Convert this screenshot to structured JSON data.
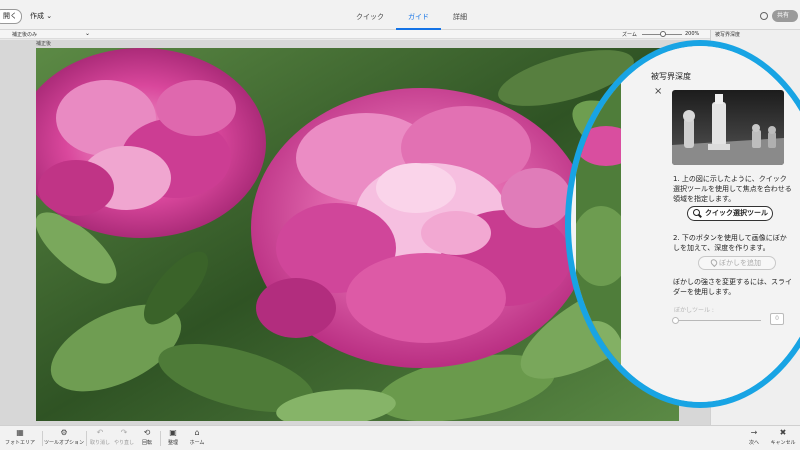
{
  "topbar": {
    "open_label": "開く",
    "create_label": "作成",
    "create_caret": "⌄",
    "tabs": [
      {
        "label": "クイック",
        "active": false
      },
      {
        "label": "ガイド",
        "active": true
      },
      {
        "label": "詳細",
        "active": false
      }
    ],
    "share_label": "共有"
  },
  "options_bar": {
    "view_label": "補正後のみ",
    "zoom_label": "ズーム",
    "zoom_value": "200%"
  },
  "canvas": {
    "doc_tab": "補正後"
  },
  "right_panel": {
    "title": "被写界深度",
    "close_glyph": "×"
  },
  "guide_panel": {
    "title": "被写界深度",
    "close_glyph": "×",
    "step1_text": "1. 上の図に示したように、クイック選択ツールを使用して焦点を合わせる領域を指定します。",
    "quick_select_label": "クイック選択ツール",
    "step2_text": "2. 下のボタンを使用して画像にぼかしを加えて、深度を作ります。",
    "add_blur_label": "ぼかしを追加",
    "step3_text": "ぼかしの強さを変更するには、スライダーを使用します。",
    "slider_label": "ぼかしツール :",
    "slider_value": "0",
    "slider_level": 0
  },
  "bottombar": {
    "items": [
      {
        "label": "フォトエリア",
        "icon": "photo-bin-icon",
        "glyph": "▦",
        "enabled": true
      },
      {
        "label": "ツールオプション",
        "icon": "tool-options-icon",
        "glyph": "⚙",
        "enabled": true
      },
      {
        "label": "取り消し",
        "icon": "undo-icon",
        "glyph": "↶",
        "enabled": false
      },
      {
        "label": "やり直し",
        "icon": "redo-icon",
        "glyph": "↷",
        "enabled": false
      },
      {
        "label": "回転",
        "icon": "rotate-icon",
        "glyph": "⟲",
        "enabled": true
      },
      {
        "label": "整理",
        "icon": "organizer-icon",
        "glyph": "▣",
        "enabled": true
      },
      {
        "label": "ホーム",
        "icon": "home-icon",
        "glyph": "⌂",
        "enabled": true
      }
    ],
    "next_label": "次へ",
    "next_glyph": "→",
    "cancel_label": "キャンセル",
    "cancel_glyph": "✖"
  },
  "colors": {
    "accent": "#1473e6",
    "callout_ring": "#18a4e4",
    "peony_pink": "#d7489b",
    "foliage": "#3f6b2f"
  }
}
